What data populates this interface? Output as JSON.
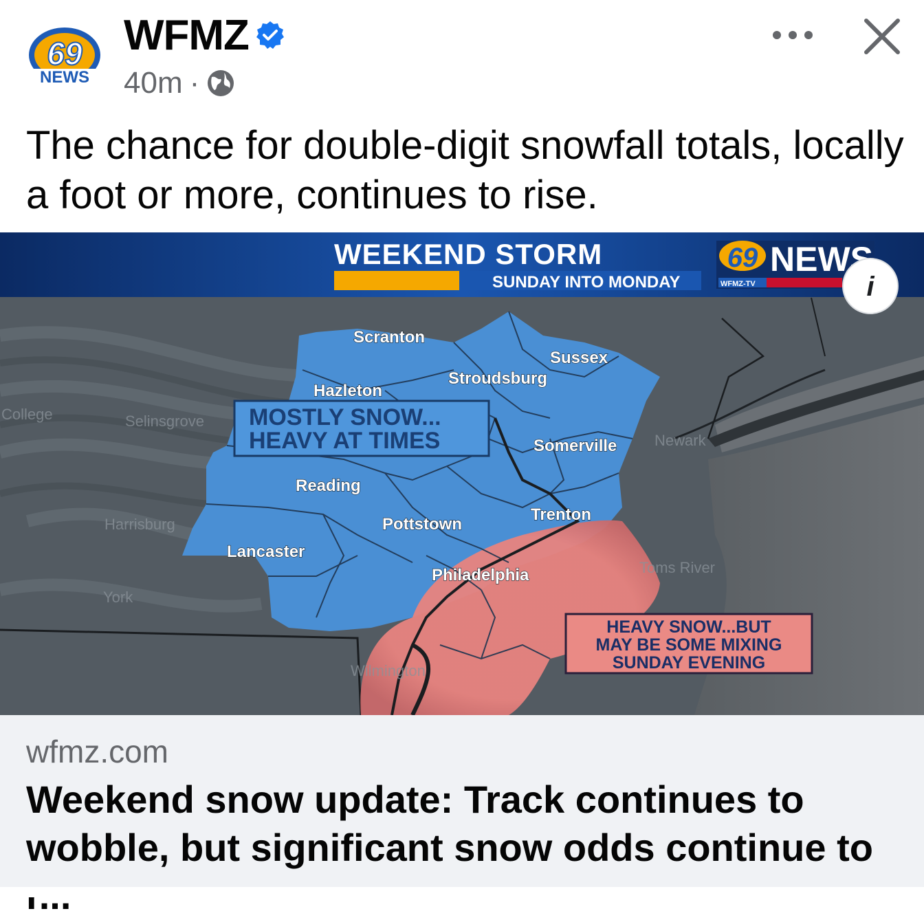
{
  "post": {
    "page_name": "WFMZ",
    "avatar": {
      "number": "69",
      "label": "NEWS"
    },
    "time": "40m",
    "separator": "·",
    "text": "The chance for double-digit snowfall totals, locally a foot or more, continues to rise."
  },
  "graphic": {
    "title": "WEEKEND STORM",
    "subtitle": "SUNDAY INTO MONDAY",
    "logo_number": "69",
    "logo_word": "NEWS",
    "logo_sub": "WFMZ-TV",
    "info_label": "i",
    "snow_box": {
      "line1": "MOSTLY SNOW...",
      "line2": "HEAVY AT TIMES"
    },
    "mix_box": {
      "line1": "HEAVY SNOW...BUT",
      "line2": "MAY BE SOME MIXING",
      "line3": "SUNDAY EVENING"
    },
    "cities": [
      "Scranton",
      "Sussex",
      "Stroudsburg",
      "Hazleton",
      "Somerville",
      "Reading",
      "Trenton",
      "Pottstown",
      "Lancaster",
      "Philadelphia"
    ],
    "faded_places": [
      "College",
      "Selinsgrove",
      "Harrisburg",
      "York",
      "Newark",
      "Toms River",
      "Wilmington"
    ],
    "colors": {
      "snow": "#4a8fd4",
      "mix": "#e8837f",
      "banner": "#1a4fa3",
      "accent": "#f5a800"
    }
  },
  "link": {
    "domain": "wfmz.com",
    "title": "Weekend snow update: Track continues to wobble, but significant snow odds continue to r..."
  },
  "icons": {
    "verified": "verified-badge-icon",
    "audience": "globe-icon",
    "more": "more-options-icon",
    "close": "close-icon"
  }
}
